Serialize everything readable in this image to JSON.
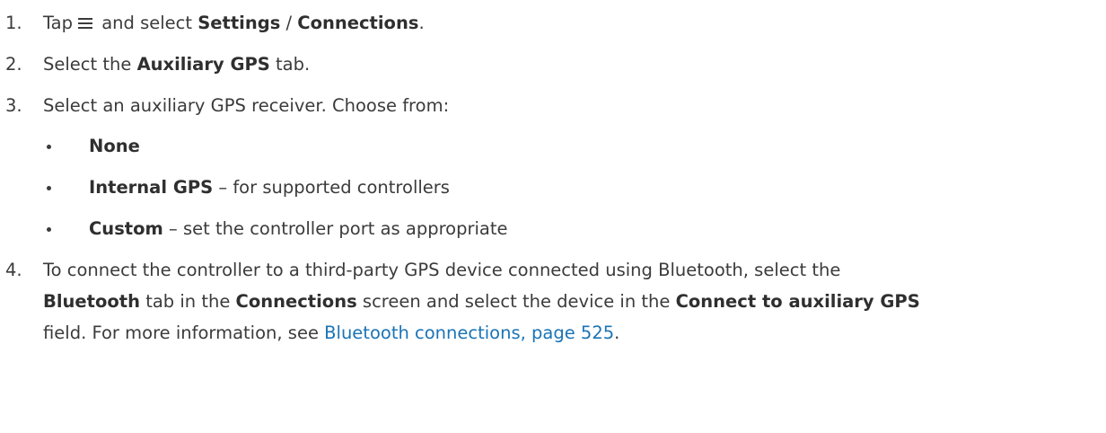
{
  "steps": [
    {
      "number": "1.",
      "text_before": "Tap",
      "icon": "menu-icon",
      "text_mid": "and select",
      "bold_1": "Settings",
      "separator": "/",
      "bold_2": "Connections",
      "text_end": "."
    },
    {
      "number": "2.",
      "text_before": "Select the",
      "bold": "Auxiliary GPS",
      "text_after": "tab."
    },
    {
      "number": "3.",
      "text": "Select an auxiliary GPS receiver. Choose from:",
      "options": [
        {
          "bold": "None",
          "rest": ""
        },
        {
          "bold": "Internal GPS",
          "rest": " – for supported controllers"
        },
        {
          "bold": "Custom",
          "rest": " – set the controller port as appropriate"
        }
      ]
    },
    {
      "number": "4.",
      "text_1": "To connect the controller to a third-party GPS device connected using Bluetooth, select the",
      "bold_1": "Bluetooth",
      "text_2": "tab in the",
      "bold_2": "Connections",
      "text_3": "screen and select the device in the",
      "bold_3": "Connect to auxiliary GPS",
      "text_4": "field. For more information, see",
      "link": "Bluetooth connections, page 525",
      "text_end": "."
    }
  ],
  "colors": {
    "text": "#3b3b3b",
    "link": "#1a74b5"
  }
}
